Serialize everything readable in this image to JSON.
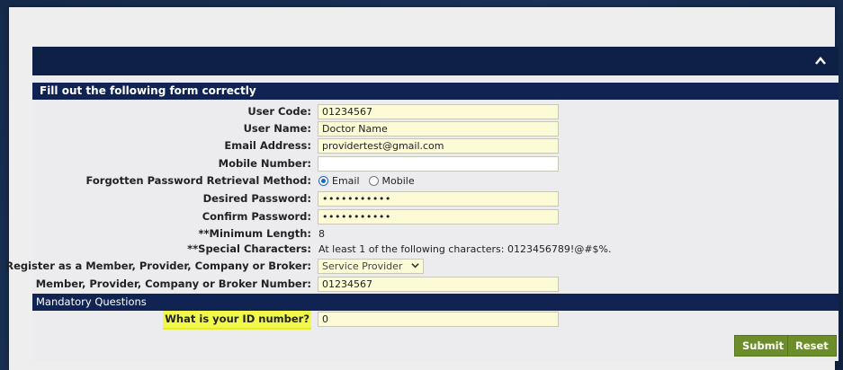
{
  "header": {
    "collapse_icon": "chevron-up-icon"
  },
  "form": {
    "title": "Fill out the following form correctly",
    "user_code": {
      "label": "User Code:",
      "value": "01234567"
    },
    "user_name": {
      "label": "User Name:",
      "value": "Doctor Name"
    },
    "email": {
      "label": "Email Address:",
      "value": "providertest@gmail.com"
    },
    "mobile": {
      "label": "Mobile Number:",
      "value": ""
    },
    "retrieval": {
      "label": "Forgotten Password Retrieval Method:",
      "options": [
        "Email",
        "Mobile"
      ],
      "selected": "Email"
    },
    "desired_password": {
      "label": "Desired Password:",
      "value": "•••••••••••"
    },
    "confirm_password": {
      "label": "Confirm Password:",
      "value": "•••••••••••"
    },
    "min_length": {
      "label": "**Minimum Length:",
      "value": "8"
    },
    "special_chars": {
      "label": "**Special Characters:",
      "value": "At least 1 of the following characters: 0123456789!@#$%."
    },
    "register_as": {
      "label": "Register as a Member, Provider, Company or Broker:",
      "value": "Service Provider"
    },
    "member_number": {
      "label": "Member, Provider, Company or Broker Number:",
      "value": "01234567"
    }
  },
  "mandatory": {
    "title": "Mandatory Questions",
    "id_question": {
      "label": "What is your ID number?",
      "value": "0"
    }
  },
  "actions": {
    "submit_label": "Submit",
    "reset_label": "Reset"
  },
  "colors": {
    "header_bar": "#0f2047",
    "input_bg": "#fdfbd6",
    "button_bg": "#6b8e2a",
    "highlight": "#f1f84a"
  }
}
